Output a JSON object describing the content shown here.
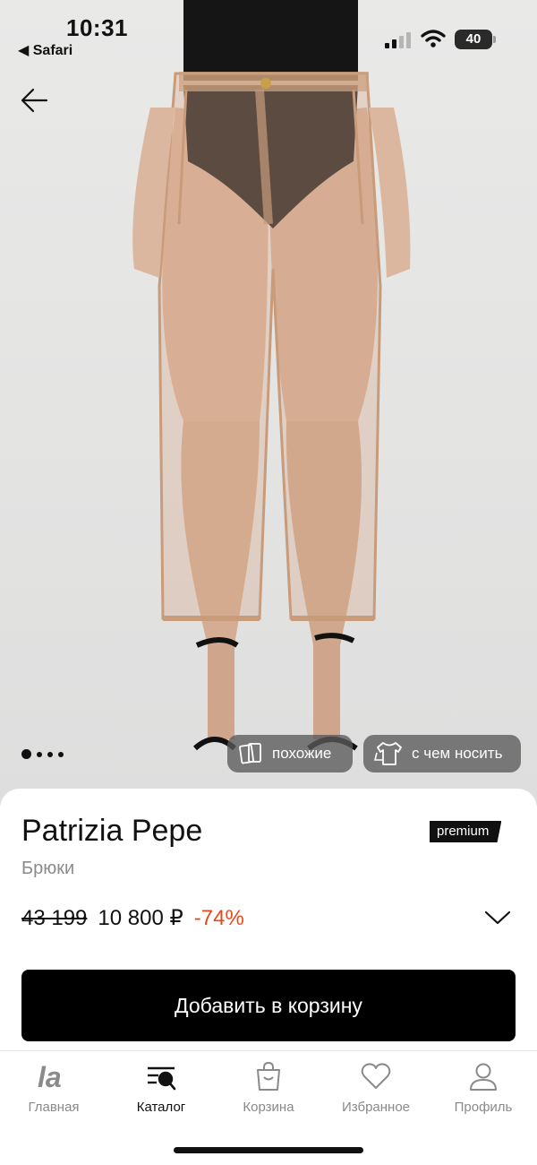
{
  "status_bar": {
    "time": "10:31",
    "back_app": "◀ Safari",
    "battery": "40"
  },
  "gallery": {
    "dots_count": 4,
    "active_dot": 0,
    "similar_label": "похожие",
    "outfit_label": "с чем носить"
  },
  "product": {
    "brand": "Patrizia Pepe",
    "badge": "premium",
    "category": "Брюки",
    "old_price": "43 199",
    "new_price": "10 800 ₽",
    "discount": "-74%",
    "add_to_cart": "Добавить в корзину"
  },
  "tabbar": {
    "items": [
      {
        "label": "Главная",
        "icon": "brand-logo-icon"
      },
      {
        "label": "Каталог",
        "icon": "catalog-search-icon"
      },
      {
        "label": "Корзина",
        "icon": "bag-icon"
      },
      {
        "label": "Избранное",
        "icon": "heart-icon"
      },
      {
        "label": "Профиль",
        "icon": "profile-icon"
      }
    ],
    "active_index": 1
  },
  "colors": {
    "discount": "#e5481a",
    "button": "#000000",
    "inactive_tab": "#8a8a8a"
  }
}
